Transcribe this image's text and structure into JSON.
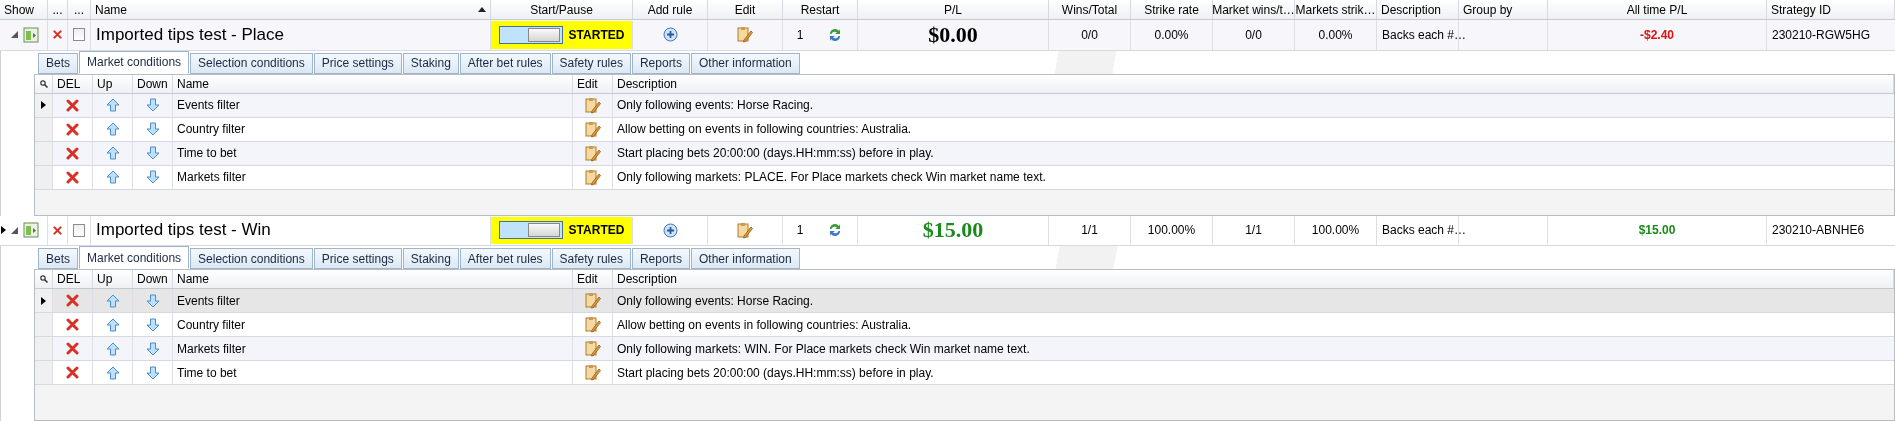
{
  "columns": [
    {
      "label": "Show"
    },
    {
      "label": "..."
    },
    {
      "label": "..."
    },
    {
      "label": "Name",
      "sorted": true
    },
    {
      "label": "Start/Pause"
    },
    {
      "label": "Add rule"
    },
    {
      "label": "Edit"
    },
    {
      "label": "Restart"
    },
    {
      "label": "P/L"
    },
    {
      "label": "Wins/Total"
    },
    {
      "label": "Strike rate"
    },
    {
      "label": "Market wins/t…"
    },
    {
      "label": "Markets strik…"
    },
    {
      "label": "Description"
    },
    {
      "label": "Group by"
    },
    {
      "label": "All time P/L"
    },
    {
      "label": "Strategy ID"
    }
  ],
  "strategies": [
    {
      "name": "Imported tips test - Place",
      "selected": false,
      "expanded": true,
      "checked": false,
      "running": true,
      "status": "STARTED",
      "restart": "1",
      "pl": {
        "text": "$0.00",
        "color": "#000000"
      },
      "wins_total": "0/0",
      "strike_rate": "0.00%",
      "market_wins": "0/0",
      "markets_strike": "0.00%",
      "description": "Backs each #…",
      "all_time_pl": {
        "text": "-$2.40",
        "color": "#e01010"
      },
      "strategy_id": "230210-RGW5HG",
      "tabs": [
        {
          "label": "Bets",
          "selected": false
        },
        {
          "label": "Market conditions",
          "selected": true
        },
        {
          "label": "Selection conditions",
          "selected": false
        },
        {
          "label": "Price settings",
          "selected": false
        },
        {
          "label": "Staking",
          "selected": false
        },
        {
          "label": "After bet rules",
          "selected": false
        },
        {
          "label": "Safety rules",
          "selected": false
        },
        {
          "label": "Reports",
          "selected": false
        },
        {
          "label": "Other information",
          "selected": false
        }
      ],
      "rule_columns": [
        "DEL",
        "Up",
        "Down",
        "Name",
        "Edit",
        "Description"
      ],
      "rules": [
        {
          "name": "Events filter",
          "description": "Only following events: Horse Racing.",
          "selected": true,
          "focused": false
        },
        {
          "name": "Country filter",
          "description": "Allow betting on events in following countries: Australia.",
          "selected": false,
          "focused": false
        },
        {
          "name": "Time to bet",
          "description": "Start placing bets 20:00:00 (days.HH:mm:ss) before in play.",
          "selected": false,
          "focused": false
        },
        {
          "name": "Markets filter",
          "description": "Only following markets: PLACE. For Place markets check Win market name text.",
          "selected": false,
          "focused": false
        }
      ]
    },
    {
      "name": "Imported tips test - Win",
      "selected": true,
      "expanded": true,
      "checked": false,
      "running": true,
      "status": "STARTED",
      "restart": "1",
      "pl": {
        "text": "$15.00",
        "color": "#1a8a1a"
      },
      "wins_total": "1/1",
      "strike_rate": "100.00%",
      "market_wins": "1/1",
      "markets_strike": "100.00%",
      "description": "Backs each #…",
      "all_time_pl": {
        "text": "$15.00",
        "color": "#1a8a1a"
      },
      "strategy_id": "230210-ABNHE6",
      "tabs": [
        {
          "label": "Bets",
          "selected": false
        },
        {
          "label": "Market conditions",
          "selected": true
        },
        {
          "label": "Selection conditions",
          "selected": false
        },
        {
          "label": "Price settings",
          "selected": false
        },
        {
          "label": "Staking",
          "selected": false
        },
        {
          "label": "After bet rules",
          "selected": false
        },
        {
          "label": "Safety rules",
          "selected": false
        },
        {
          "label": "Reports",
          "selected": false
        },
        {
          "label": "Other information",
          "selected": false
        }
      ],
      "rule_columns": [
        "DEL",
        "Up",
        "Down",
        "Name",
        "Edit",
        "Description"
      ],
      "rules": [
        {
          "name": "Events filter",
          "description": "Only following events: Horse Racing.",
          "selected": true,
          "focused": true
        },
        {
          "name": "Country filter",
          "description": "Allow betting on events in following countries: Australia.",
          "selected": false,
          "focused": false
        },
        {
          "name": "Markets filter",
          "description": "Only following markets: WIN. For Place markets check Win market name text.",
          "selected": false,
          "focused": false
        },
        {
          "name": "Time to bet",
          "description": "Start placing bets 20:00:00 (days.HH:mm:ss) before in play.",
          "selected": false,
          "focused": false
        }
      ]
    }
  ]
}
